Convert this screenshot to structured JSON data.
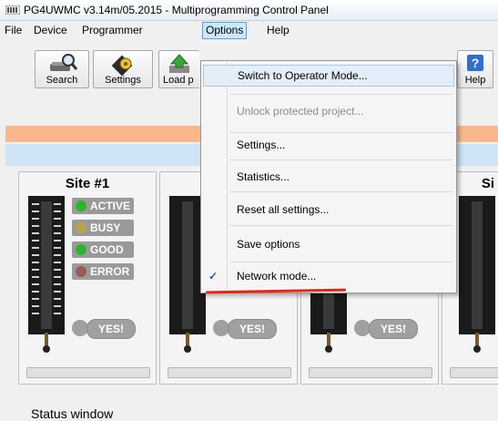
{
  "window": {
    "title": "PG4UWMC v3.14m/05.2015 - Multiprogramming Control Panel"
  },
  "menubar": {
    "file": "File",
    "device": "Device",
    "programmer": "Programmer",
    "options": "Options",
    "help": "Help"
  },
  "toolbar": {
    "search": "Search",
    "settings": "Settings",
    "load": "Load p",
    "help": "Help"
  },
  "options_menu": {
    "switch_operator": "Switch to Operator Mode...",
    "unlock": "Unlock protected project...",
    "settings": "Settings...",
    "statistics": "Statistics...",
    "reset": "Reset all settings...",
    "save": "Save options",
    "network": "Network mode...",
    "network_checked": true,
    "check_mark": "✓"
  },
  "sites": [
    {
      "title": "Site #1",
      "active": "ACTIVE",
      "busy": "BUSY",
      "good": "GOOD",
      "error": "ERROR",
      "yes": "YES!"
    },
    {
      "yes": "YES!"
    },
    {
      "yes": "YES!"
    },
    {
      "title": "Si"
    }
  ],
  "status": {
    "text": "Status window"
  },
  "colors": {
    "orange_bar": "#f9b88c",
    "blue_bar": "#cfe4f6",
    "active_led": "#2db52d",
    "busy_led": "#b8a34e",
    "good_led": "#2db52d",
    "error_led": "#9c5a55",
    "accent": "#1f5fb5",
    "annotation": "#e0281c"
  }
}
